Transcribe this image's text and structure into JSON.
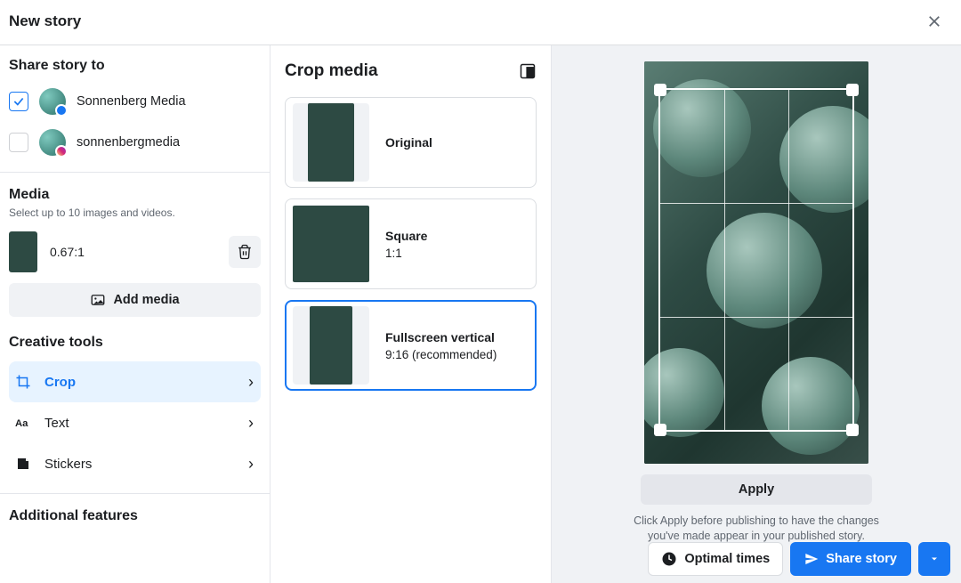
{
  "header": {
    "title": "New story"
  },
  "share": {
    "heading": "Share story to",
    "accounts": [
      {
        "name": "Sonnenberg Media",
        "checked": true,
        "network": "fb"
      },
      {
        "name": "sonnenbergmedia",
        "checked": false,
        "network": "ig"
      }
    ]
  },
  "media": {
    "heading": "Media",
    "hint": "Select up to 10 images and videos.",
    "items": [
      {
        "ratio": "0.67:1"
      }
    ],
    "add_label": "Add media"
  },
  "tools": {
    "heading": "Creative tools",
    "items": [
      {
        "id": "crop",
        "label": "Crop",
        "active": true
      },
      {
        "id": "text",
        "label": "Text",
        "active": false
      },
      {
        "id": "stickers",
        "label": "Stickers",
        "active": false
      }
    ]
  },
  "additional": {
    "heading": "Additional features"
  },
  "crop": {
    "heading": "Crop media",
    "options": [
      {
        "id": "original",
        "title": "Original",
        "sub": "",
        "selected": false
      },
      {
        "id": "square",
        "title": "Square",
        "sub": "1:1",
        "selected": false
      },
      {
        "id": "fullscreen",
        "title": "Fullscreen vertical",
        "sub": "9:16 (recommended)",
        "selected": true
      }
    ]
  },
  "preview": {
    "apply_label": "Apply",
    "apply_hint": "Click Apply before publishing to have the changes you've made appear in your published story."
  },
  "footer": {
    "optimal_label": "Optimal times",
    "share_label": "Share story"
  }
}
